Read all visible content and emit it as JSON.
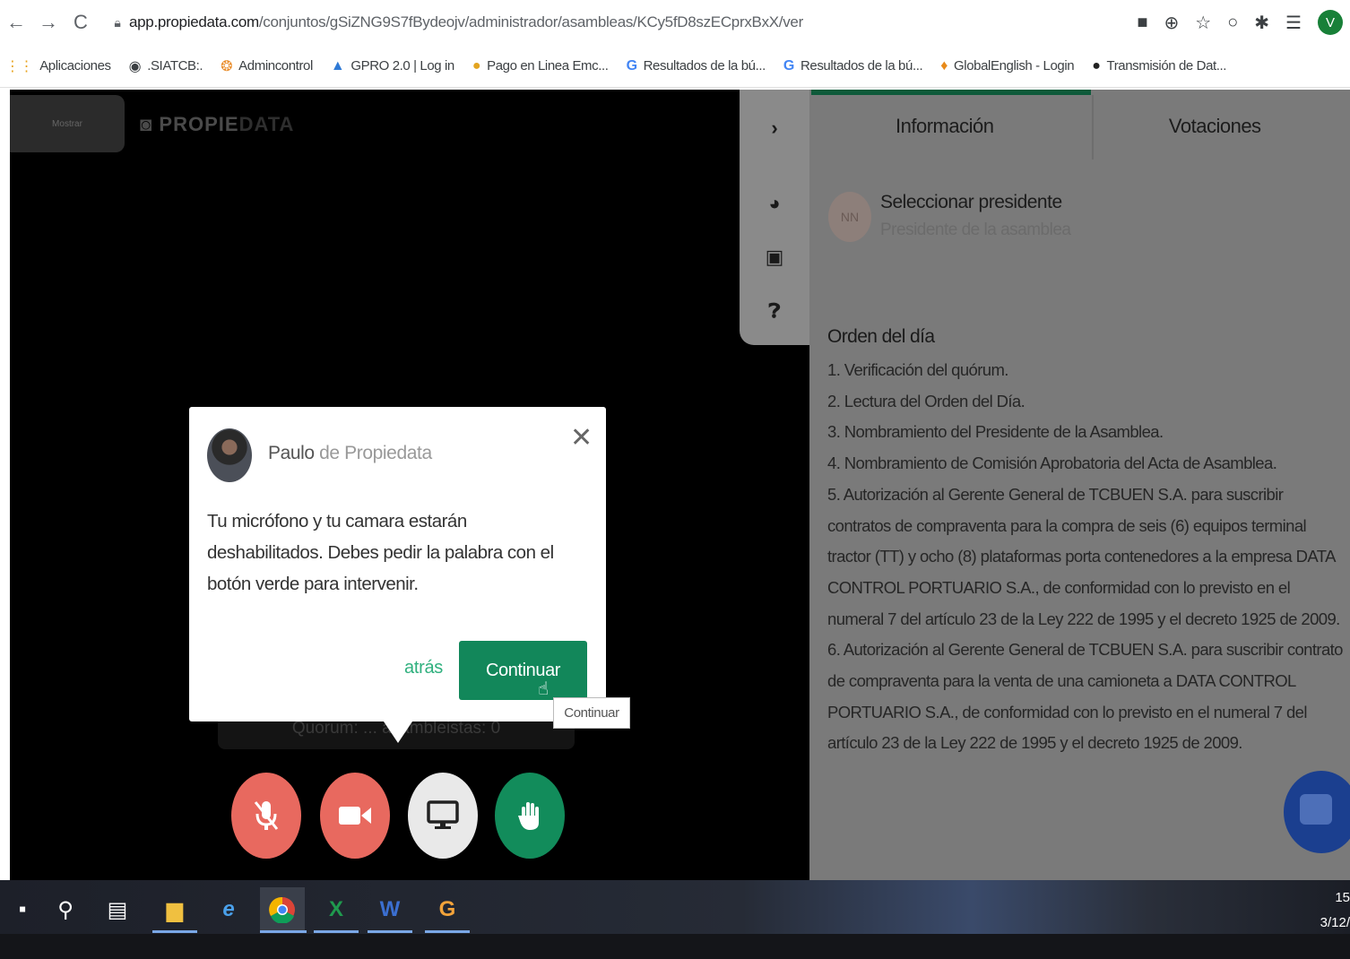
{
  "browser": {
    "url_host": "app.propiedata.com",
    "url_path": "/conjuntos/gSiZNG9S7fBydeojv/administrador/asambleas/KCy5fD8szECprxBxX/ver",
    "profile_initial": "V",
    "bookmarks": [
      {
        "label": "Aplicaciones",
        "icon": "apps-grid-icon"
      },
      {
        "label": ".SIATCB:.",
        "icon": "globe-icon"
      },
      {
        "label": "Admincontrol",
        "icon": "admincontrol-icon"
      },
      {
        "label": "GPRO 2.0 | Log in",
        "icon": "gpro-icon"
      },
      {
        "label": "Pago en Linea Emc...",
        "icon": "pago-icon"
      },
      {
        "label": "Resultados de la bú...",
        "icon": "google-icon"
      },
      {
        "label": "Resultados de la bú...",
        "icon": "google-icon"
      },
      {
        "label": "GlobalEnglish - Login",
        "icon": "globalenglish-icon"
      },
      {
        "label": "Transmisión de Dat...",
        "icon": "transmision-icon"
      }
    ]
  },
  "video": {
    "mostrar_label": "Mostrar",
    "brand_a": "PROPIE",
    "brand_b": "DATA",
    "quorum_text": "Quorum: ... asambleistas: 0"
  },
  "dialog": {
    "sender_name": "Paulo",
    "sender_org": "de Propiedata",
    "message": "Tu micrófono y tu camara estarán deshabilitados. Debes pedir la palabra con el botón verde para intervenir.",
    "back_label": "atrás",
    "continue_label": "Continuar",
    "tooltip": "Continuar"
  },
  "panel": {
    "tabs": [
      "Información",
      "Votaciones"
    ],
    "active_tab": "Información",
    "president_initials": "NN",
    "president_title": "Seleccionar presidente",
    "president_sub": "Presidente de la asamblea",
    "orden_title": "Orden del día",
    "orden_items": [
      "1. Verificación del quórum.",
      "2. Lectura del Orden del Día.",
      "3. Nombramiento del Presidente de la Asamblea.",
      "4. Nombramiento de Comisión Aprobatoria del Acta de Asamblea.",
      "5. Autorización al Gerente General de TCBUEN S.A. para suscribir contratos de compraventa para la compra de seis (6) equipos terminal tractor (TT) y ocho (8) plataformas porta contenedores a la empresa DATA CONTROL PORTUARIO S.A., de conformidad con lo previsto en el numeral 7 del artículo 23 de la Ley 222 de 1995 y el decreto 1925 de 2009.",
      "6. Autorización al Gerente General de TCBUEN S.A. para suscribir contrato de compraventa para la venta de una camioneta a DATA CONTROL PORTUARIO S.A., de conformidad con lo previsto en el numeral 7 del artículo 23 de la Ley 222 de 1995 y el decreto 1925 de 2009."
    ]
  },
  "taskbar": {
    "clock_time": "15",
    "clock_date": "3/12/"
  },
  "colors": {
    "brand_green": "#12875a",
    "mute_red": "#e8695f",
    "link_green": "#2fb07e"
  }
}
